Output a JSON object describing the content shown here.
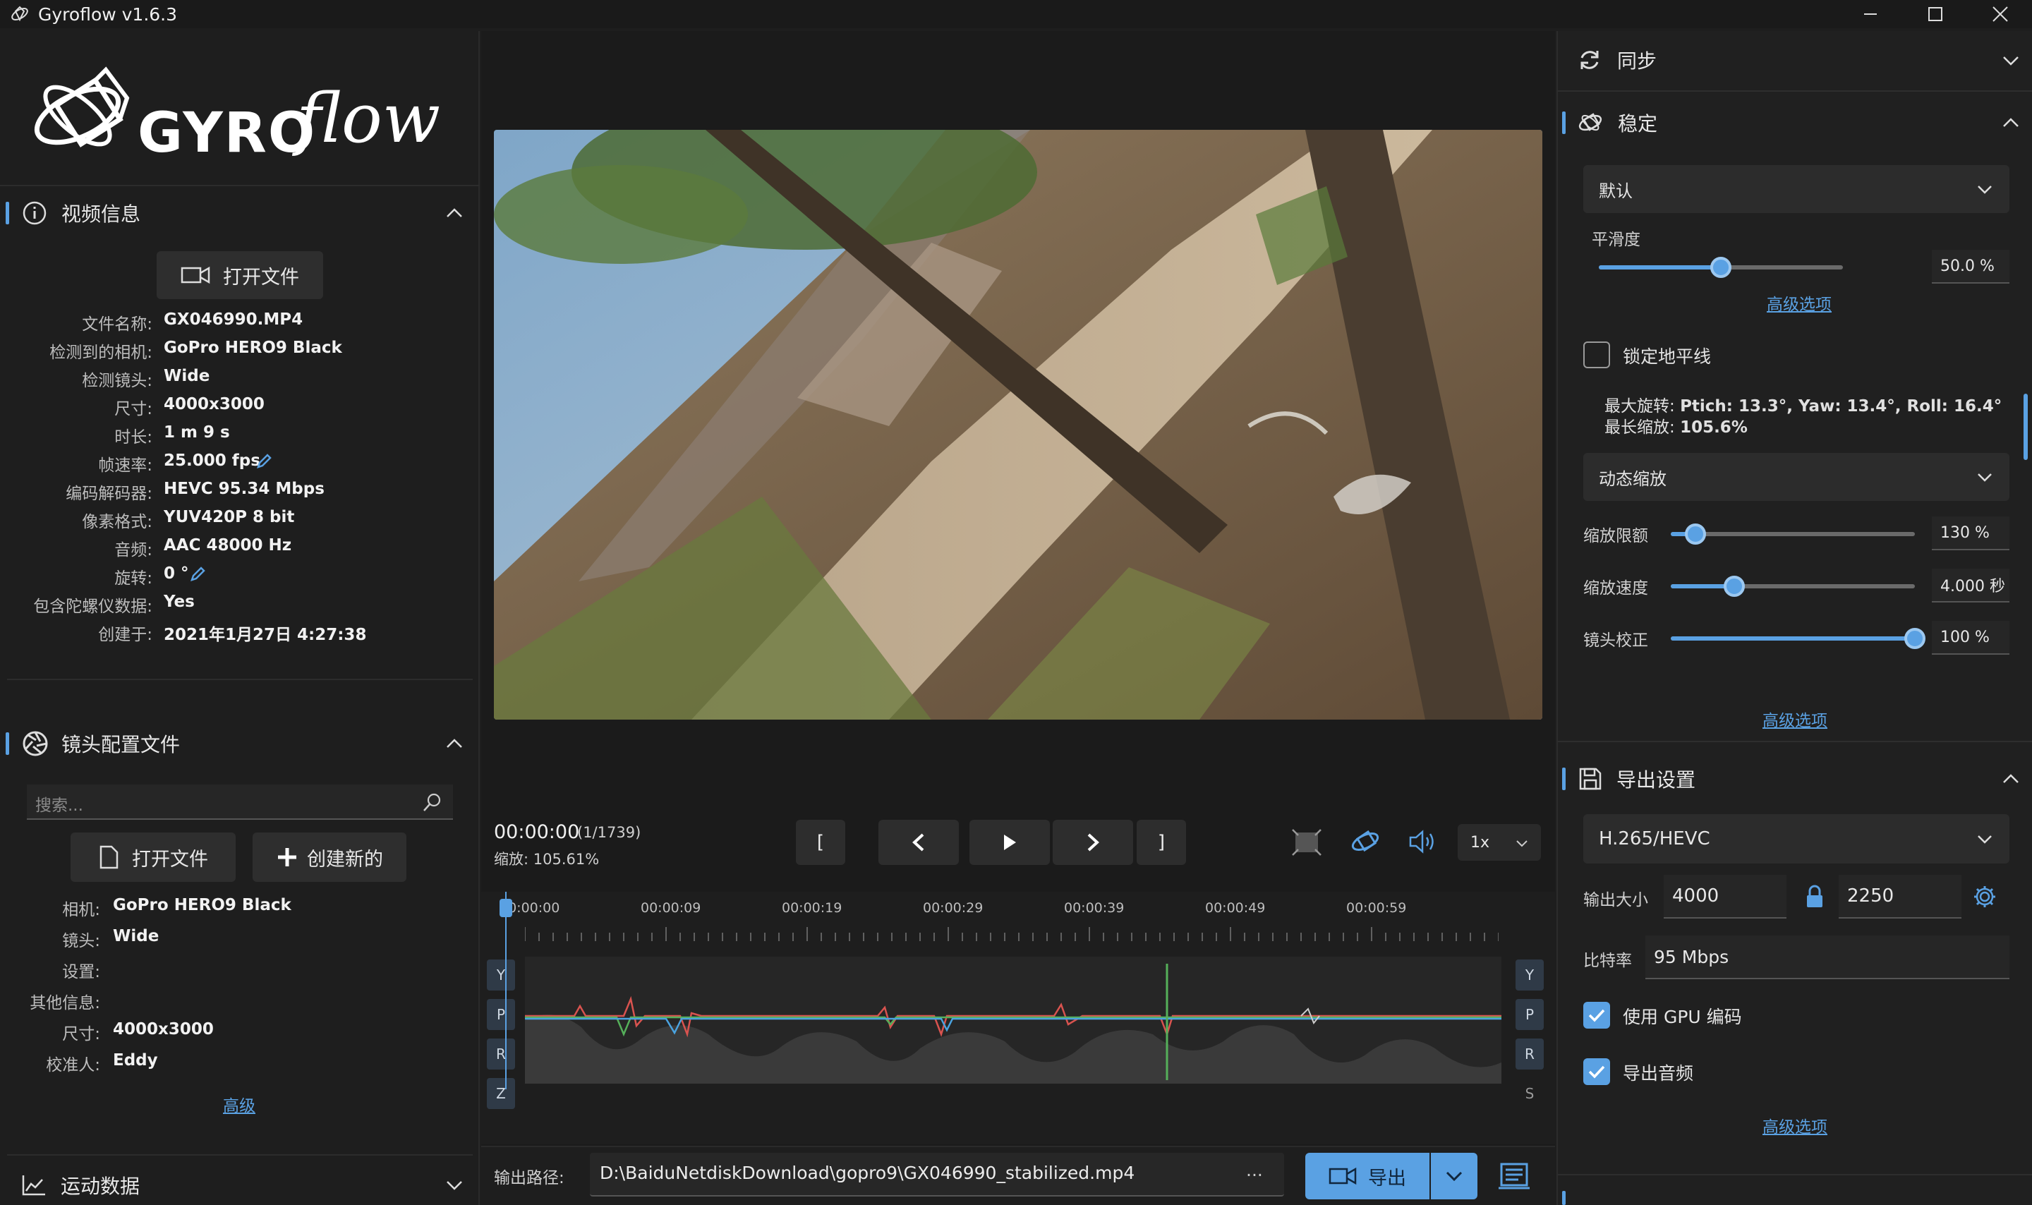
{
  "app": {
    "title": "Gyroflow v1.6.3",
    "logo_text": "GYRO",
    "logo_script": "flow"
  },
  "video_info": {
    "section_title": "视频信息",
    "open_file": "打开文件",
    "rows": [
      {
        "label": "文件名称:",
        "value": "GX046990.MP4"
      },
      {
        "label": "检测到的相机:",
        "value": "GoPro HERO9 Black"
      },
      {
        "label": "检测镜头:",
        "value": "Wide"
      },
      {
        "label": "尺寸:",
        "value": "4000x3000"
      },
      {
        "label": "时长:",
        "value": "1 m 9 s"
      },
      {
        "label": "帧速率:",
        "value": "25.000 fps"
      },
      {
        "label": "编码解码器:",
        "value": "HEVC 95.34 Mbps"
      },
      {
        "label": "像素格式:",
        "value": "YUV420P 8 bit"
      },
      {
        "label": "音频:",
        "value": "AAC 48000 Hz"
      },
      {
        "label": "旋转:",
        "value": "0 °"
      },
      {
        "label": "包含陀螺仪数据:",
        "value": "Yes"
      },
      {
        "label": "创建于:",
        "value": "2021年1月27日 4:27:38"
      }
    ]
  },
  "lens_profile": {
    "section_title": "镜头配置文件",
    "search_placeholder": "搜索...",
    "open_file": "打开文件",
    "create_new": "创建新的",
    "rows": [
      {
        "label": "相机:",
        "value": "GoPro HERO9 Black"
      },
      {
        "label": "镜头:",
        "value": "Wide"
      },
      {
        "label": "设置:",
        "value": ""
      },
      {
        "label": "其他信息:",
        "value": ""
      },
      {
        "label": "尺寸:",
        "value": "4000x3000"
      },
      {
        "label": "校准人:",
        "value": "Eddy"
      }
    ],
    "advanced_link": "高级"
  },
  "motion_data": {
    "section_title": "运动数据"
  },
  "playback": {
    "timecode": "00:00:00",
    "frame": "(1/1739)",
    "zoom": "缩放: 105.61%",
    "speed": "1x",
    "btn_in": "[",
    "btn_out": "]"
  },
  "timeline": {
    "ticks": [
      "00:00:00",
      "00:00:09",
      "00:00:19",
      "00:00:29",
      "00:00:39",
      "00:00:49",
      "00:00:59"
    ],
    "left_axes": [
      "Y",
      "P",
      "R",
      "Z"
    ],
    "right_axes": [
      "Y",
      "P",
      "R",
      "S"
    ]
  },
  "output": {
    "label": "输出路径:",
    "path": "D:\\BaiduNetdiskDownload\\gopro9\\GX046990_stabilized.mp4",
    "more": "...",
    "export_label": "导出"
  },
  "sync": {
    "section_title": "同步"
  },
  "stabilization": {
    "section_title": "稳定",
    "method": "默认",
    "smoothness_label": "平滑度",
    "smoothness_value": "50.0 %",
    "smoothness_level": 0.5,
    "advanced_link": "高级选项",
    "lock_horizon": "锁定地平线",
    "max_rotation_prefix": "最大旋转: ",
    "max_rotation": "Ptich: 13.3°, Yaw: 13.4°, Roll: 16.4°",
    "max_zoom_prefix": "最长缩放: ",
    "max_zoom": "105.6%",
    "zoom_mode": "动态缩放",
    "zoom_limit_label": "缩放限额",
    "zoom_limit_value": "130 %",
    "zoom_limit_level": 0.1,
    "zoom_speed_label": "缩放速度",
    "zoom_speed_value": "4.000 秒",
    "zoom_speed_level": 0.26,
    "lens_correction_label": "镜头校正",
    "lens_correction_value": "100 %",
    "lens_correction_level": 1.0,
    "advanced_link2": "高级选项"
  },
  "export_settings": {
    "section_title": "导出设置",
    "codec": "H.265/HEVC",
    "size_label": "输出大小",
    "width": "4000",
    "height": "2250",
    "bitrate_label": "比特率",
    "bitrate": "95 Mbps",
    "use_gpu": "使用 GPU 编码",
    "export_audio": "导出音频",
    "advanced_link": "高级选项"
  },
  "colors": {
    "accent": "#5aa1e3",
    "yaw": "#4aa3e0",
    "pitch": "#55b05a",
    "roll": "#d9534f"
  }
}
